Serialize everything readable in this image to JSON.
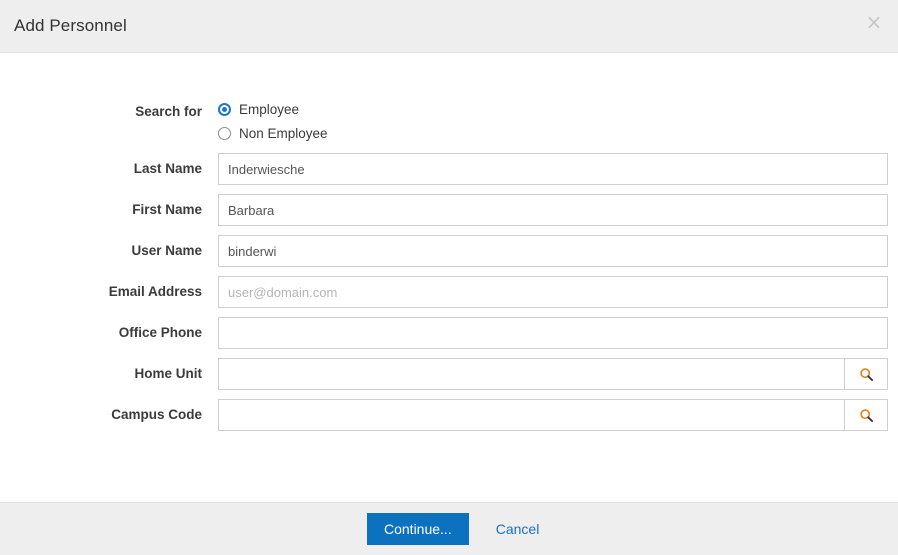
{
  "dialog": {
    "title": "Add Personnel",
    "close_icon": "close-icon",
    "close_label": "×"
  },
  "form": {
    "search_for": {
      "label": "Search for",
      "options": [
        {
          "label": "Employee",
          "selected": true
        },
        {
          "label": "Non Employee",
          "selected": false
        }
      ]
    },
    "fields": [
      {
        "label": "Last Name",
        "value": "Inderwiesche",
        "placeholder": "",
        "lookup": false
      },
      {
        "label": "First Name",
        "value": "Barbara",
        "placeholder": "",
        "lookup": false
      },
      {
        "label": "User Name",
        "value": "binderwi",
        "placeholder": "",
        "lookup": false
      },
      {
        "label": "Email Address",
        "value": "",
        "placeholder": "user@domain.com",
        "lookup": false
      },
      {
        "label": "Office Phone",
        "value": "",
        "placeholder": "",
        "lookup": false
      },
      {
        "label": "Home Unit",
        "value": "",
        "placeholder": "",
        "lookup": true
      },
      {
        "label": "Campus Code",
        "value": "",
        "placeholder": "",
        "lookup": true
      }
    ],
    "lookup_icon": "search-icon"
  },
  "footer": {
    "continue_label": "Continue...",
    "cancel_label": "Cancel"
  },
  "colors": {
    "primary": "#0c72c0",
    "link": "#1a6fc4",
    "radio_selected": "#1977d4",
    "header_bg": "#eeeeee",
    "lookup_icon_rim": "#e08214"
  }
}
